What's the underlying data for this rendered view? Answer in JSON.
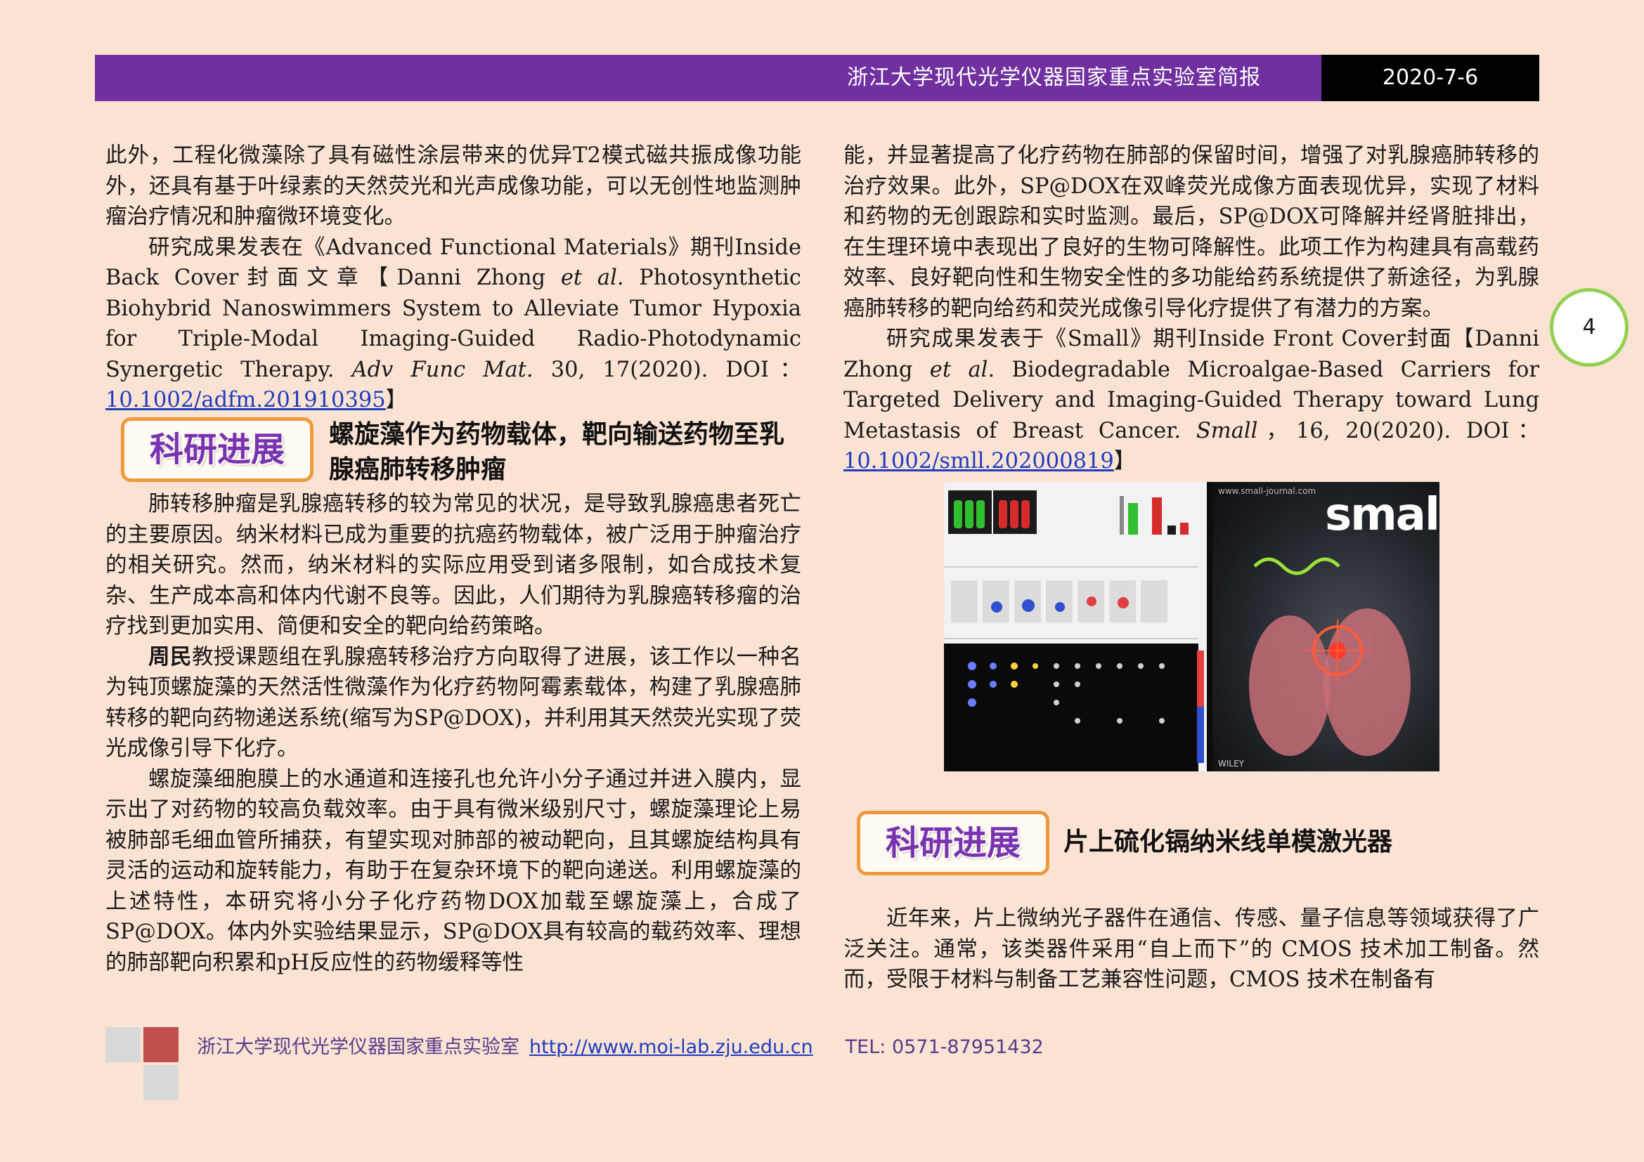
{
  "header": {
    "title": "浙江大学现代光学仪器国家重点实验室简报",
    "date": "2020-7-6"
  },
  "page_number": "4",
  "left": {
    "p1": "此外，工程化微藻除了具有磁性涂层带来的优异T2模式磁共振成像功能外，还具有基于叶绿素的天然荧光和光声成像功能，可以无创性地监测肿瘤治疗情况和肿瘤微环境变化。",
    "p2_pre": "研究成果发表在《Advanced Functional Materials》期刊Inside Back Cover封面文章【Danni Zhong ",
    "p2_etal": "et al",
    "p2_mid": ". Photosynthetic Biohybrid Nanoswimmers System to Alleviate Tumor Hypoxia for Triple-Modal Imaging-Guided Radio-Photodynamic Synergetic Therapy. ",
    "p2_journal": "Adv Func Mat.",
    "p2_vol": " 30, 17(2020). DOI：",
    "p2_doi": "10.1002/adfm.201910395",
    "p2_end": "】",
    "section1_badge": "科研进展",
    "section1_title": "螺旋藻作为药物载体，靶向输送药物至乳腺癌肺转移肿瘤",
    "p3": "肺转移肿瘤是乳腺癌转移的较为常见的状况，是导致乳腺癌患者死亡的主要原因。纳米材料已成为重要的抗癌药物载体，被广泛用于肿瘤治疗的相关研究。然而，纳米材料的实际应用受到诸多限制，如合成技术复杂、生产成本高和体内代谢不良等。因此，人们期待为乳腺癌转移瘤的治疗找到更加实用、简便和安全的靶向给药策略。",
    "p4_name": "周民",
    "p4_rest": "教授课题组在乳腺癌转移治疗方向取得了进展，该工作以一种名为钝顶螺旋藻的天然活性微藻作为化疗药物阿霉素载体，构建了乳腺癌肺转移的靶向药物递送系统(缩写为SP@DOX)，并利用其天然荧光实现了荧光成像引导下化疗。",
    "p5": "螺旋藻细胞膜上的水通道和连接孔也允许小分子通过并进入膜内，显示出了对药物的较高负载效率。由于具有微米级别尺寸，螺旋藻理论上易被肺部毛细血管所捕获，有望实现对肺部的被动靶向，且其螺旋结构具有灵活的运动和旋转能力，有助于在复杂环境下的靶向递送。利用螺旋藻的上述特性，本研究将小分子化疗药物DOX加载至螺旋藻上，合成了SP@DOX。体内外实验结果显示，SP@DOX具有较高的载药效率、理想的肺部靶向积累和pH反应性的药物缓释等性"
  },
  "right": {
    "p1": "能，并显著提高了化疗药物在肺部的保留时间，增强了对乳腺癌肺转移的治疗效果。此外，SP@DOX在双峰荧光成像方面表现优异，实现了材料和药物的无创跟踪和实时监测。最后，SP@DOX可降解并经肾脏排出，在生理环境中表现出了良好的生物可降解性。此项工作为构建具有高载药效率、良好靶向性和生物安全性的多功能给药系统提供了新途径，为乳腺癌肺转移的靶向给药和荧光成像引导化疗提供了有潜力的方案。",
    "p2_pre": "研究成果发表于《Small》期刊Inside Front Cover封面【Danni Zhong ",
    "p2_etal": "et al",
    "p2_mid": ". Biodegradable Microalgae-Based Carriers for Targeted Delivery and Imaging-Guided Therapy toward Lung Metastasis of Breast Cancer. ",
    "p2_journal": "Small",
    "p2_vol": "，16, 20(2020). DOI：",
    "p2_doi": "10.1002/smll.202000819",
    "p2_end": "】",
    "figure": {
      "cover_url": "www.small-journal.com",
      "cover_word": "small",
      "publisher": "WILEY"
    },
    "section2_badge": "科研进展",
    "section2_title": "片上硫化镉纳米线单模激光器",
    "p3": "近年来，片上微纳光子器件在通信、传感、量子信息等领域获得了广泛关注。通常，该类器件采用“自上而下”的 CMOS 技术加工制备。然而，受限于材料与制备工艺兼容性问题，CMOS 技术在制备有"
  },
  "footer": {
    "lab": "浙江大学现代光学仪器国家重点实验室",
    "url": "http://www.moi-lab.zju.edu.cn",
    "tel": "TEL: 0571-87951432"
  },
  "colors": {
    "header_bar": "#7030a0",
    "date_box": "#000000",
    "badge_border": "#ed9a3d",
    "badge_text": "#7a33b0",
    "page_circle": "#92d050",
    "footer_gray": "#d9d9d9",
    "footer_red": "#c0504d"
  }
}
